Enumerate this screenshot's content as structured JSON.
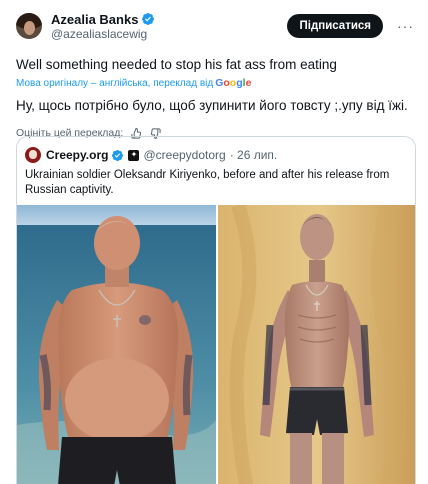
{
  "post": {
    "author_name": "Azealia Banks",
    "author_handle": "@azealiaslacewig",
    "subscribe_label": "Підписатися",
    "more_label": "···",
    "text_original": "Well something needed to stop his fat ass from eating",
    "translation_note": "Мова оригіналу – англійська, переклад від",
    "google_letters": [
      "G",
      "o",
      "o",
      "g",
      "l",
      "e"
    ],
    "text_translated": "Ну, щось потрібно було, щоб зупинити його товсту ;.упу від їжі.",
    "rate_label": "Оцініть цей переклад:"
  },
  "quote": {
    "author_name": "Creepy.org",
    "author_handle": "@creepydotorg",
    "date": "· 26 лип.",
    "text": "Ukrainian soldier Oleksandr Kiriyenko, before and after his release from Russian captivity."
  },
  "colors": {
    "accent": "#1d9bf0",
    "text": "#0f1419",
    "muted": "#536471",
    "border": "#cfd9de"
  }
}
